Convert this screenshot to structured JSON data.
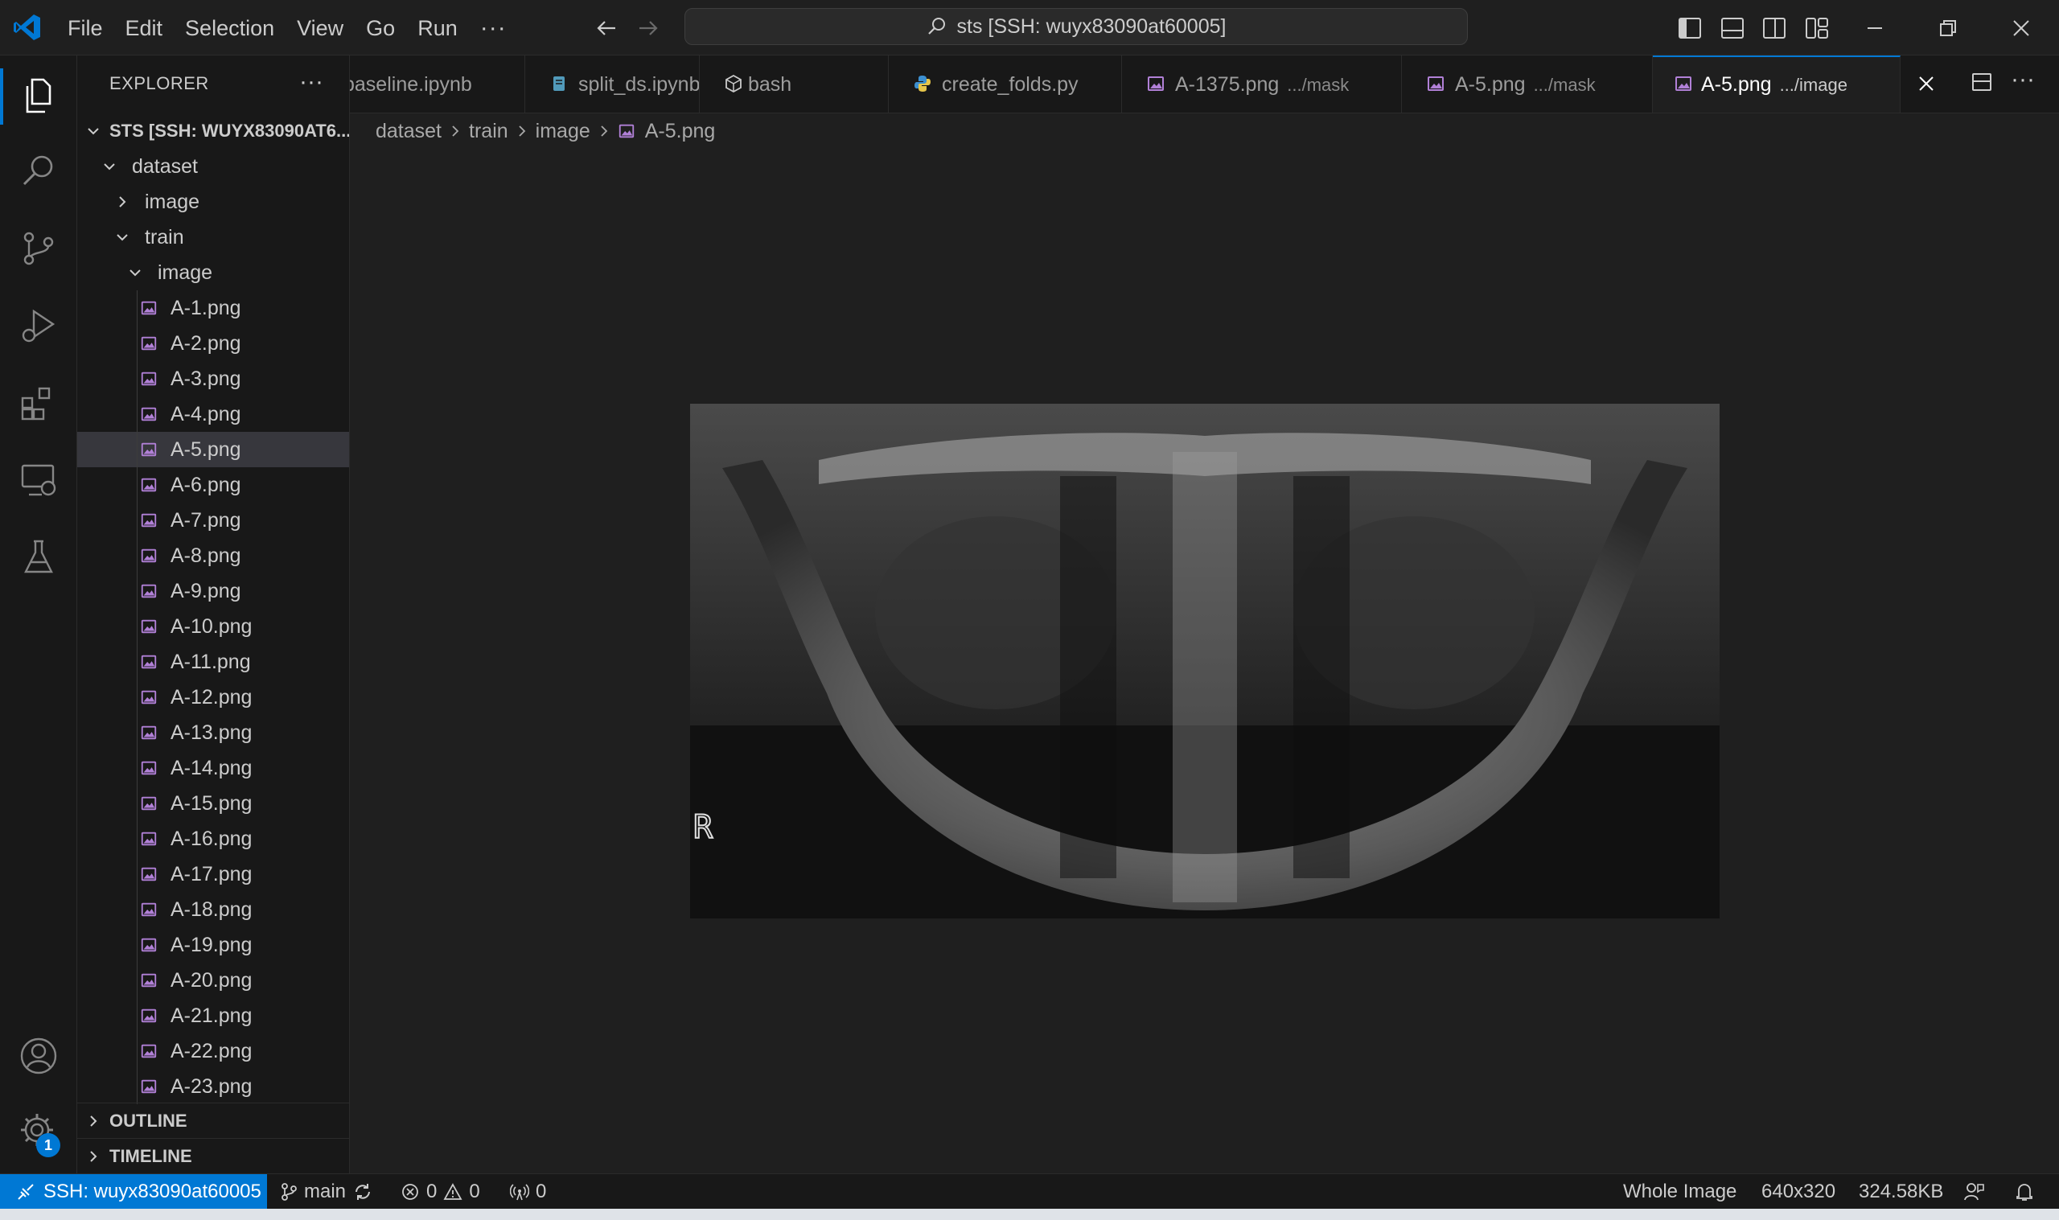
{
  "titlebar": {
    "menu": [
      "File",
      "Edit",
      "Selection",
      "View",
      "Go",
      "Run"
    ],
    "menu_more": "···",
    "command_center": "sts [SSH: wuyx83090at60005]"
  },
  "activitybar": {
    "icons": [
      "explorer-icon",
      "search-icon",
      "source-control-icon",
      "run-debug-icon",
      "extensions-icon",
      "remote-explorer-icon",
      "testing-icon",
      "accounts-icon",
      "manage-gear-icon"
    ],
    "settings_badge": "1"
  },
  "sidebar": {
    "header": "EXPLORER",
    "more": "···",
    "root": "STS [SSH: WUYX83090AT6...",
    "folders": {
      "dataset": "dataset",
      "image": "image",
      "train": "train",
      "train_image": "image"
    },
    "files": [
      "A-1.png",
      "A-2.png",
      "A-3.png",
      "A-4.png",
      "A-5.png",
      "A-6.png",
      "A-7.png",
      "A-8.png",
      "A-9.png",
      "A-10.png",
      "A-11.png",
      "A-12.png",
      "A-13.png",
      "A-14.png",
      "A-15.png",
      "A-16.png",
      "A-17.png",
      "A-18.png",
      "A-19.png",
      "A-20.png",
      "A-21.png",
      "A-22.png",
      "A-23.png"
    ],
    "selected_file": "A-5.png",
    "outline": "OUTLINE",
    "timeline": "TIMELINE"
  },
  "tabs": [
    {
      "label": "baseline.ipynb",
      "icon": "notebook-icon",
      "desc": ""
    },
    {
      "label": "split_ds.ipynb",
      "icon": "notebook-icon",
      "desc": ""
    },
    {
      "label": "bash",
      "icon": "terminal-cube-icon",
      "desc": ""
    },
    {
      "label": "create_folds.py",
      "icon": "python-icon",
      "desc": ""
    },
    {
      "label": "A-1375.png",
      "icon": "image-file-icon",
      "desc": ".../mask"
    },
    {
      "label": "A-5.png",
      "icon": "image-file-icon",
      "desc": ".../mask"
    },
    {
      "label": "A-5.png",
      "icon": "image-file-icon",
      "desc": ".../image",
      "active": true
    }
  ],
  "breadcrumb": [
    "dataset",
    "train",
    "image",
    "A-5.png"
  ],
  "preview": {
    "marker_letter": "R"
  },
  "statusbar": {
    "remote": "SSH: wuyx83090at60005",
    "branch": "main",
    "errors": "0",
    "warnings": "0",
    "ports": "0",
    "zoom": "Whole Image",
    "dimensions": "640x320",
    "size": "324.58KB"
  },
  "colors": {
    "accent": "#0078d4",
    "image_icon": "#b180d7",
    "notebook_icon": "#519aba",
    "python_icon": "#3c8fd0"
  }
}
